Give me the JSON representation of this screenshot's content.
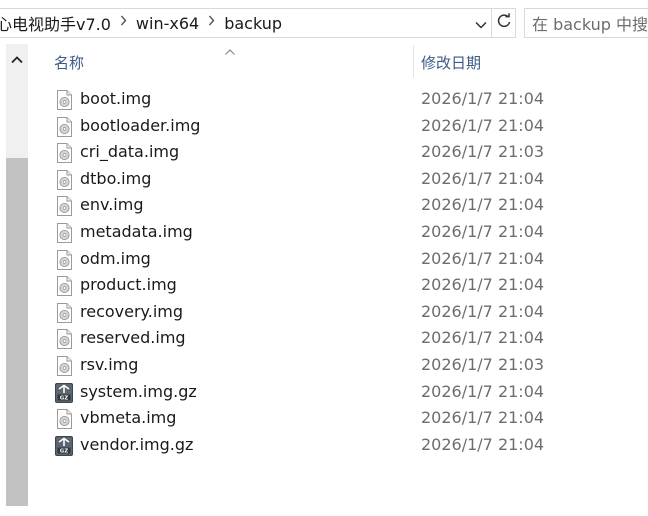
{
  "address": {
    "crumbs": [
      "心电视助手v7.0",
      "win-x64",
      "backup"
    ]
  },
  "search": {
    "placeholder": "在 backup 中搜索"
  },
  "columns": {
    "name": "名称",
    "modified": "修改日期"
  },
  "icons": {
    "separator": "chevron-right-icon",
    "dropdown": "chevron-down-icon",
    "refresh": "refresh-icon",
    "img_file": "disc-image-file-icon",
    "gz_file": "gz-archive-file-icon"
  },
  "files": [
    {
      "name": "boot.img",
      "modified": "2026/1/7 21:04",
      "kind": "img"
    },
    {
      "name": "bootloader.img",
      "modified": "2026/1/7 21:04",
      "kind": "img"
    },
    {
      "name": "cri_data.img",
      "modified": "2026/1/7 21:03",
      "kind": "img"
    },
    {
      "name": "dtbo.img",
      "modified": "2026/1/7 21:04",
      "kind": "img"
    },
    {
      "name": "env.img",
      "modified": "2026/1/7 21:04",
      "kind": "img"
    },
    {
      "name": "metadata.img",
      "modified": "2026/1/7 21:04",
      "kind": "img"
    },
    {
      "name": "odm.img",
      "modified": "2026/1/7 21:04",
      "kind": "img"
    },
    {
      "name": "product.img",
      "modified": "2026/1/7 21:04",
      "kind": "img"
    },
    {
      "name": "recovery.img",
      "modified": "2026/1/7 21:04",
      "kind": "img"
    },
    {
      "name": "reserved.img",
      "modified": "2026/1/7 21:04",
      "kind": "img"
    },
    {
      "name": "rsv.img",
      "modified": "2026/1/7 21:03",
      "kind": "img"
    },
    {
      "name": "system.img.gz",
      "modified": "2026/1/7 21:04",
      "kind": "gz"
    },
    {
      "name": "vbmeta.img",
      "modified": "2026/1/7 21:04",
      "kind": "img"
    },
    {
      "name": "vendor.img.gz",
      "modified": "2026/1/7 21:04",
      "kind": "gz"
    }
  ]
}
